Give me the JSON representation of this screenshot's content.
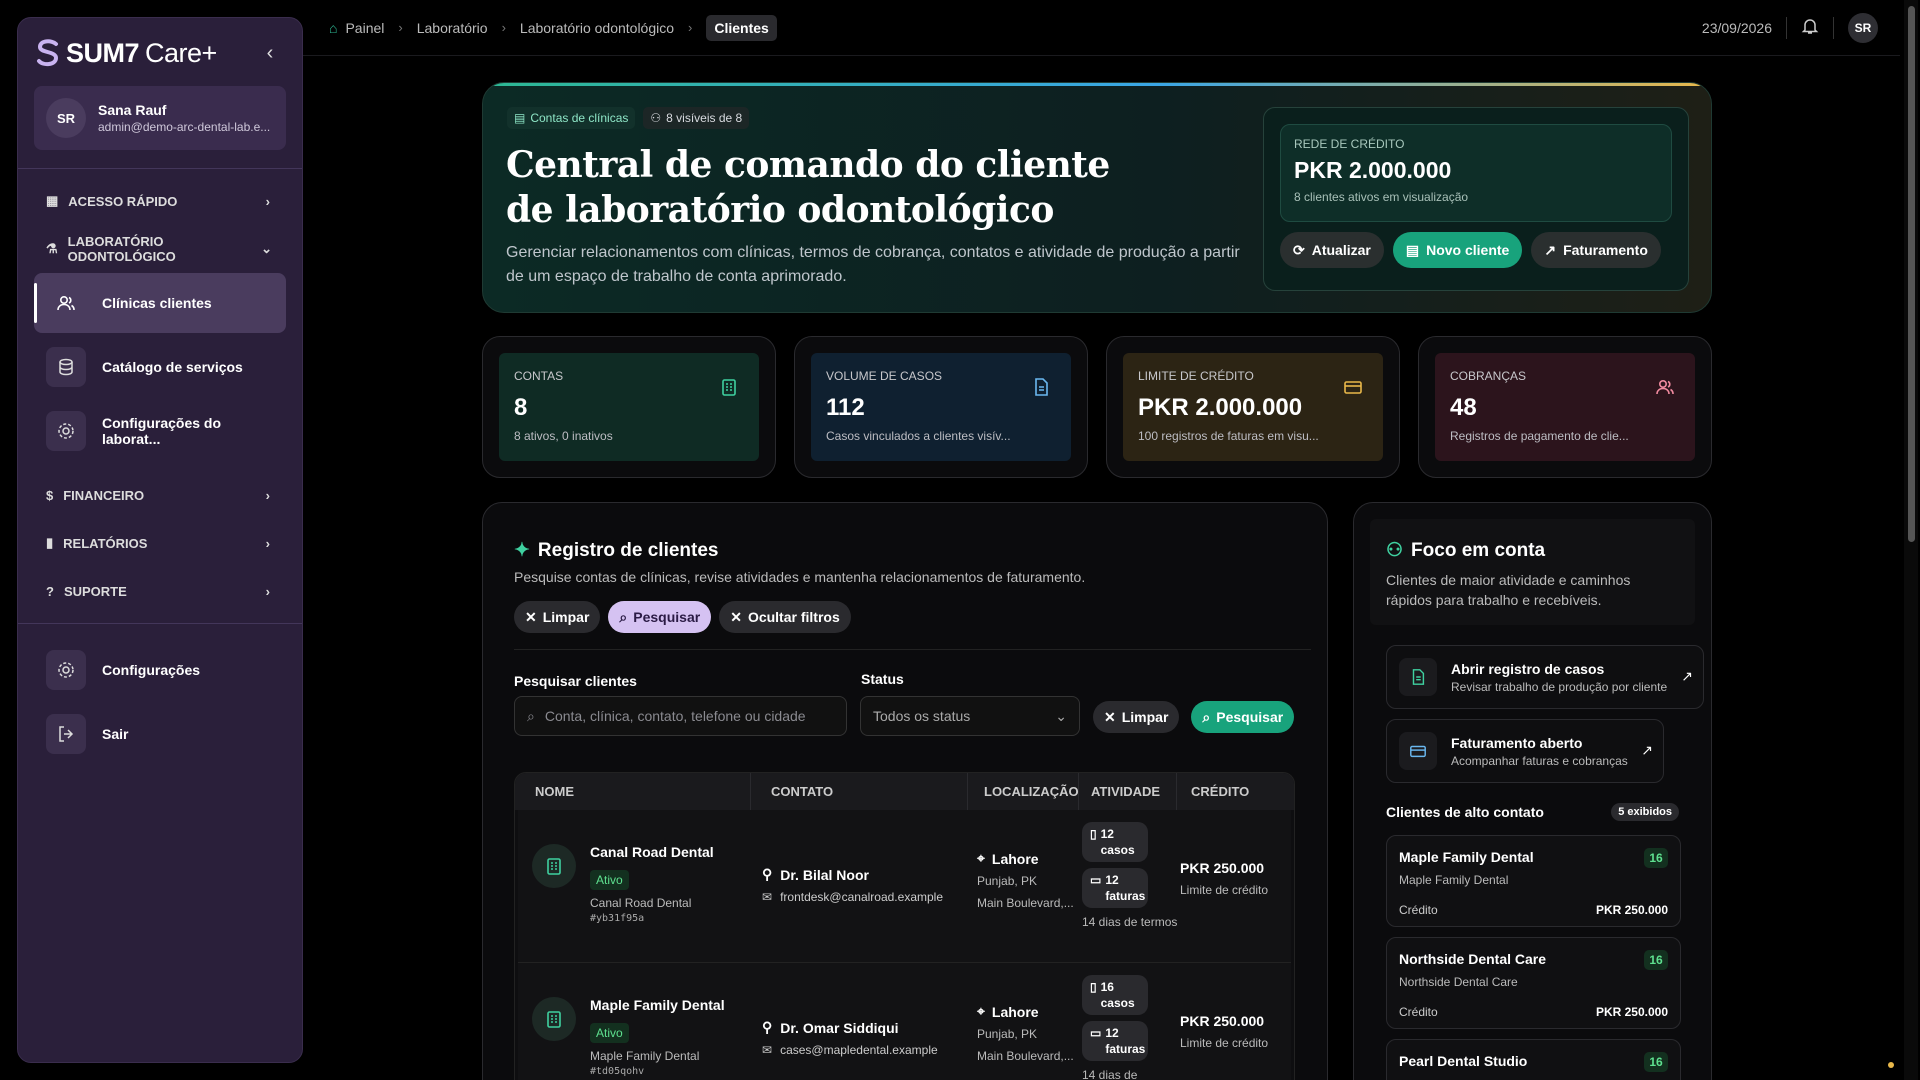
{
  "brand": {
    "name": "SUM7",
    "suffix": "Care+"
  },
  "user": {
    "initials": "SR",
    "name": "Sana Rauf",
    "email": "admin@demo-arc-dental-lab.e..."
  },
  "sidebar": {
    "quick_access": "ACESSO RÁPIDO",
    "lab_section": "LABORATÓRIO ODONTOLÓGICO",
    "items": [
      {
        "label": "Clínicas clientes"
      },
      {
        "label": "Catálogo de serviços"
      },
      {
        "label": "Configurações do laborat..."
      }
    ],
    "financial": "FINANCEIRO",
    "reports": "RELATÓRIOS",
    "support": "SUPORTE",
    "settings": "Configurações",
    "logout": "Sair"
  },
  "breadcrumb": [
    "Painel",
    "Laboratório",
    "Laboratório odontológico",
    "Clientes"
  ],
  "topbar": {
    "date": "23/09/2026",
    "initials": "SR"
  },
  "hero": {
    "tag1": "Contas de clínicas",
    "tag2": "8 visíveis de 8",
    "title": "Central de comando do cliente de laboratório odontológico",
    "description": "Gerenciar relacionamentos com clínicas, termos de cobrança, contatos e atividade de produção a partir de um espaço de trabalho de conta aprimorado.",
    "credit_label": "REDE DE CRÉDITO",
    "credit_value": "PKR 2.000.000",
    "credit_sub": "8 clientes ativos em visualização",
    "btn_refresh": "Atualizar",
    "btn_new": "Novo cliente",
    "btn_billing": "Faturamento"
  },
  "stats": [
    {
      "label": "CONTAS",
      "value": "8",
      "sub": "8 ativos, 0 inativos"
    },
    {
      "label": "VOLUME DE CASOS",
      "value": "112",
      "sub": "Casos vinculados a clientes visív..."
    },
    {
      "label": "LIMITE DE CRÉDITO",
      "value": "PKR 2.000.000",
      "sub": "100 registros de faturas em visu..."
    },
    {
      "label": "COBRANÇAS",
      "value": "48",
      "sub": "Registros de pagamento de clie..."
    }
  ],
  "registry": {
    "title": "Registro de clientes",
    "subtitle": "Pesquise contas de clínicas, revise atividades e mantenha relacionamentos de faturamento.",
    "chip_clear": "Limpar",
    "chip_search": "Pesquisar",
    "chip_hide": "Ocultar filtros",
    "search_label": "Pesquisar clientes",
    "search_placeholder": "Conta, clínica, contato, telefone ou cidade",
    "status_label": "Status",
    "status_value": "Todos os status",
    "btn_clear": "Limpar",
    "btn_search": "Pesquisar",
    "columns": [
      "NOME",
      "CONTATO",
      "LOCALIZAÇÃO",
      "ATIVIDADE",
      "CRÉDITO"
    ],
    "rows": [
      {
        "name": "Canal Road Dental",
        "status": "Ativo",
        "clinic": "Canal Road Dental",
        "id": "#yb31f95a",
        "contact": "Dr. Bilal Noor",
        "email": "frontdesk@canalroad.example",
        "city": "Lahore",
        "region": "Punjab, PK",
        "address": "Main Boulevard,...",
        "cases_n": "12",
        "cases_w": "casos",
        "invoices_n": "12",
        "invoices_w": "faturas",
        "terms": "14 dias de termos",
        "credit": "PKR 250.000",
        "credit_sub": "Limite de crédito"
      },
      {
        "name": "Maple Family Dental",
        "status": "Ativo",
        "clinic": "Maple Family Dental",
        "id": "#td05qohv",
        "contact": "Dr. Omar Siddiqui",
        "email": "cases@mapledental.example",
        "city": "Lahore",
        "region": "Punjab, PK",
        "address": "Main Boulevard,...",
        "cases_n": "16",
        "cases_w": "casos",
        "invoices_n": "12",
        "invoices_w": "faturas",
        "terms": "14 dias de",
        "credit": "PKR 250.000",
        "credit_sub": "Limite de crédito"
      }
    ]
  },
  "focus": {
    "title": "Foco em conta",
    "subtitle": "Clientes de maior atividade e caminhos rápidos para trabalho e recebíveis.",
    "link1_title": "Abrir registro de casos",
    "link1_sub": "Revisar trabalho de produção por cliente",
    "link2_title": "Faturamento aberto",
    "link2_sub": "Acompanhar faturas e cobranças",
    "top_title": "Clientes de alto contato",
    "top_badge": "5 exibidos",
    "cards": [
      {
        "name": "Maple Family Dental",
        "sub": "Maple Family Dental",
        "count": "16",
        "credit_label": "Crédito",
        "credit": "PKR 250.000"
      },
      {
        "name": "Northside Dental Care",
        "sub": "Northside Dental Care",
        "count": "16",
        "credit_label": "Crédito",
        "credit": "PKR 250.000"
      },
      {
        "name": "Pearl Dental Studio",
        "sub": "",
        "count": "16",
        "credit_label": "",
        "credit": ""
      }
    ]
  },
  "colors": {
    "accent_green": "#18a37c",
    "lavender": "#d5c2f2",
    "sidebar": "#2a1f3a"
  }
}
